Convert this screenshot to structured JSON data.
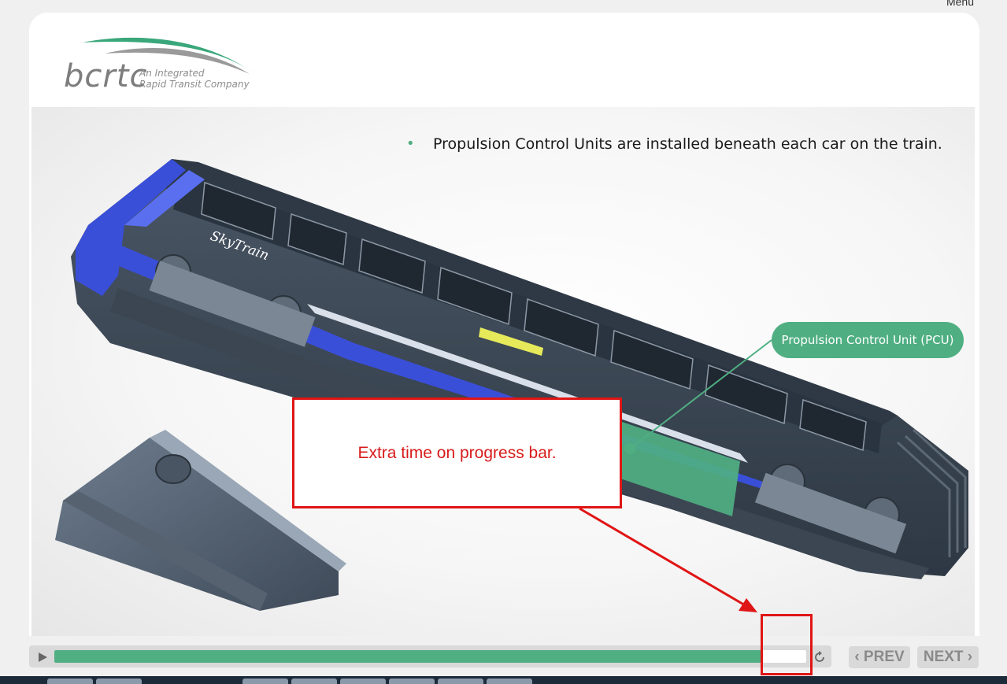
{
  "top": {
    "menu_label": "Menu"
  },
  "logo": {
    "wordmark": "bcrtc",
    "tagline_line1": "An Integrated",
    "tagline_line2": "Rapid Transit Company"
  },
  "slide": {
    "bullet": "Propulsion Control Units are installed beneath each car on the train.",
    "callout_label": "Propulsion Control Unit (PCU)",
    "train_brand": "SkyTrain"
  },
  "annotation": {
    "text": "Extra time on progress bar."
  },
  "player": {
    "progress_percent": 94,
    "prev_label": "‹ PREV",
    "next_label": "NEXT ›",
    "play_icon": "play-icon",
    "replay_icon": "replay-icon"
  },
  "colors": {
    "accent_green": "#4faf82",
    "annotation_red": "#e01515",
    "train_blue": "#3a4fd8"
  }
}
